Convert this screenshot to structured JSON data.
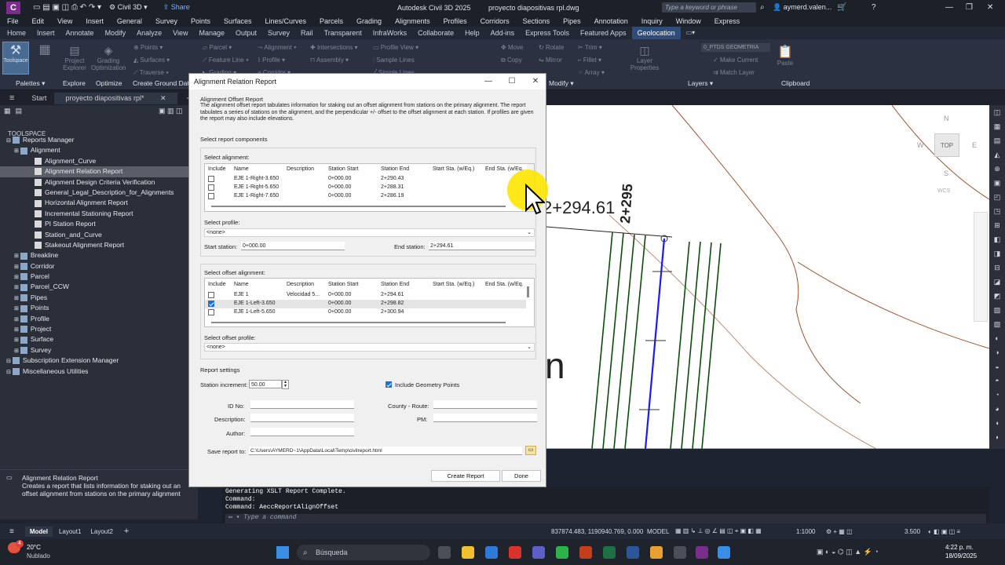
{
  "app": {
    "title": "Autodesk Civil 3D 2025",
    "file": "proyecto diapositivas rpl.dwg",
    "workspace": "Civil 3D",
    "share": "Share",
    "search_placeholder": "Type a keyword or phrase",
    "user": "aymerd.valen..."
  },
  "menu": [
    "File",
    "Edit",
    "View",
    "Insert",
    "General",
    "Survey",
    "Points",
    "Surfaces",
    "Lines/Curves",
    "Parcels",
    "Grading",
    "Alignments",
    "Profiles",
    "Corridors",
    "Sections",
    "Pipes",
    "Annotation",
    "Inquiry",
    "Window",
    "Express"
  ],
  "ribbon_tabs": [
    "Home",
    "Insert",
    "Annotate",
    "Modify",
    "Analyze",
    "View",
    "Manage",
    "Output",
    "Survey",
    "Rail",
    "Transparent",
    "InfraWorks",
    "Collaborate",
    "Help",
    "Add-ins",
    "Express Tools",
    "Featured Apps",
    "Geolocation"
  ],
  "ribbon": {
    "toolspace": "Toolspace",
    "project_explorer": "Project Explorer",
    "grading_optimization": "Grading Optimization",
    "parcel": "Parcel",
    "feature_line": "Feature Line",
    "grading": "Grading",
    "points": "Points",
    "surfaces": "Surfaces",
    "traverse": "Traverse",
    "alignment": "Alignment",
    "profile": "Profile",
    "corridor": "Corridor",
    "intersections": "Intersections",
    "assembly": "Assembly",
    "sample_lines": "Sample Lines",
    "profile_view": "Profile View",
    "simple_lines": "Simple Lines",
    "move": "Move",
    "copy": "Copy",
    "rotate": "Rotate",
    "mirror": "Mirror",
    "trim": "Trim",
    "fillet": "Fillet",
    "array": "Array",
    "layer_properties": "Layer Properties",
    "layer_name": "0_PTDS GEOMETRIA",
    "make_current": "Make Current",
    "match_layer": "Match Layer",
    "paste": "Paste",
    "groups": {
      "palettes": "Palettes",
      "explore": "Explore",
      "optimize": "Optimize",
      "create_ground_data": "Create Ground Data",
      "modify": "Modify",
      "layers": "Layers",
      "clipboard": "Clipboard"
    }
  },
  "doc_tabs": {
    "start": "Start",
    "active": "proyecto diapositivas rpl*"
  },
  "toolspace": {
    "title": "TOOLSPACE",
    "tree": [
      {
        "label": "Reports Manager",
        "indent": 0
      },
      {
        "label": "Alignment",
        "indent": 1
      },
      {
        "label": "Alignment_Curve",
        "indent": 2
      },
      {
        "label": "Alignment Relation Report",
        "indent": 2,
        "selected": true
      },
      {
        "label": "Alignment Design Criteria Verification",
        "indent": 2
      },
      {
        "label": "General_Legal_Description_for_Alignments",
        "indent": 2
      },
      {
        "label": "Horizontal Alignment Report",
        "indent": 2
      },
      {
        "label": "Incremental Stationing Report",
        "indent": 2
      },
      {
        "label": "PI Station Report",
        "indent": 2
      },
      {
        "label": "Station_and_Curve",
        "indent": 2
      },
      {
        "label": "Stakeout Alignment Report",
        "indent": 2
      },
      {
        "label": "Breakline",
        "indent": 1
      },
      {
        "label": "Corridor",
        "indent": 1
      },
      {
        "label": "Parcel",
        "indent": 1
      },
      {
        "label": "Parcel_CCW",
        "indent": 1
      },
      {
        "label": "Pipes",
        "indent": 1
      },
      {
        "label": "Points",
        "indent": 1
      },
      {
        "label": "Profile",
        "indent": 1
      },
      {
        "label": "Project",
        "indent": 1
      },
      {
        "label": "Surface",
        "indent": 1
      },
      {
        "label": "Survey",
        "indent": 1
      },
      {
        "label": "Subscription Extension Manager",
        "indent": 0
      },
      {
        "label": "Miscellaneous Utilities",
        "indent": 0
      }
    ],
    "desc_title": "Alignment Relation Report",
    "desc_text": "Creates a report that lists information for staking out an offset alignment from stations on the primary alignment"
  },
  "dialog": {
    "title": "Alignment Relation Report",
    "heading": "Alignment Offset Report",
    "intro": "The alignment offset report tabulates information for staking out an offset alignment from stations on the primary alignment. The report tabulates a series of stations on the alignment, and the perpendicular +/- offset to the offset alignment at each station. If profiles are given the report may also include elevations.",
    "components_label": "Select report components",
    "select_alignment": "Select alignment:",
    "columns": [
      "Include",
      "Name",
      "Description",
      "Station Start",
      "Station End",
      "Start Sta. (w/Eq.)",
      "End Sta. (w/Eq."
    ],
    "alignments": [
      {
        "name": "EJE 1-Right-3.650",
        "desc": "",
        "start": "0+000.00",
        "end": "2+290.43",
        "checked": false
      },
      {
        "name": "EJE 1-Right-5.650",
        "desc": "",
        "start": "0+000.00",
        "end": "2+288.31",
        "checked": false
      },
      {
        "name": "EJE 1-Right-7.650",
        "desc": "",
        "start": "0+000.00",
        "end": "2+286.19",
        "checked": false
      }
    ],
    "select_profile": "Select profile:",
    "profile_value": "<none>",
    "start_station_label": "Start station:",
    "start_station": "0+000.00",
    "end_station_label": "End station:",
    "end_station": "2+294.61",
    "select_offset": "Select offset alignment:",
    "offset_columns": [
      "Include",
      "Name",
      "Description",
      "Station Start",
      "Station End",
      "Start Sta. (w/Eq.)",
      "End Sta. (w/Eq."
    ],
    "offsets": [
      {
        "name": "EJE 1",
        "desc": "Velocidad 5...",
        "start": "0+000.00",
        "end": "2+294.61",
        "checked": false
      },
      {
        "name": "EJE 1-Left-3.650",
        "desc": "",
        "start": "0+000.00",
        "end": "2+298.82",
        "checked": true
      },
      {
        "name": "EJE 1-Left-5.650",
        "desc": "",
        "start": "0+000.00",
        "end": "2+300.94",
        "checked": false
      }
    ],
    "select_offset_profile": "Select offset profile:",
    "offset_profile_value": "<none>",
    "report_settings": "Report settings",
    "station_increment_label": "Station increment:",
    "station_increment": "50.00",
    "include_geometry": "Include Geometry Points",
    "id_label": "ID No:",
    "county_label": "County - Route:",
    "description_label": "Description:",
    "pm_label": "PM:",
    "author_label": "Author:",
    "save_label": "Save report to:",
    "save_path": "C:\\Users\\AYMERD~1\\AppData\\Local\\Temp\\civilreport.html",
    "create_button": "Create Report",
    "done_button": "Done"
  },
  "drawing": {
    "station_label": "2+294.61",
    "station_vert": "2+295",
    "partial_text": "n",
    "viewcube_top": "TOP",
    "compass_n": "N",
    "compass_s": "S",
    "compass_e": "E",
    "compass_w": "W",
    "wcs": "WCS"
  },
  "command": {
    "lines": [
      "Generating XSLT Report Complete.",
      "Command:",
      "Command: AeccReportAlignOffset"
    ],
    "placeholder": "Type a command"
  },
  "status": {
    "model_tab": "Model",
    "layout1": "Layout1",
    "layout2": "Layout2",
    "coords": "837874.483, 1190940.769, 0.000",
    "model": "MODEL",
    "scale": "1:1000",
    "value": "3.500"
  },
  "taskbar": {
    "temp": "20°C",
    "weather": "Nublado",
    "search": "Búsqueda",
    "time": "4:22 p. m.",
    "date": "18/09/2025",
    "badge": "4"
  },
  "colors": {
    "accent": "#2f4d7a",
    "checkbox": "#1f6fd0",
    "alignment_blue": "#1a1aff",
    "cursor_highlight": "#ffe600"
  }
}
